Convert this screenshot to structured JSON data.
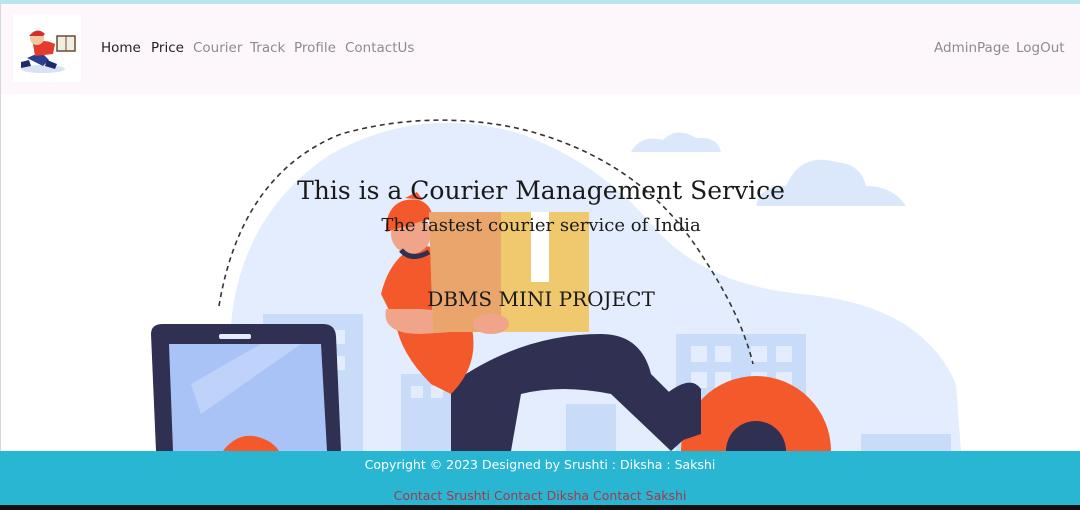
{
  "navbar": {
    "logo_alt": "courier delivery logo",
    "left_links": [
      {
        "label": "Home",
        "active": true
      },
      {
        "label": "Price",
        "active": true
      },
      {
        "label": "Courier",
        "active": false
      },
      {
        "label": "Track",
        "active": false
      },
      {
        "label": "Profile",
        "active": false
      },
      {
        "label": "ContactUs",
        "active": false
      }
    ],
    "right_links": [
      {
        "label": "AdminPage"
      },
      {
        "label": "LogOut"
      }
    ]
  },
  "hero": {
    "title": "This is a Courier Management Service",
    "subtitle": "The fastest courier service of India",
    "project_label": "DBMS MINI PROJECT"
  },
  "footer": {
    "copyright": "Copyright © 2023 Designed by Srushti : Diksha : Sakshi",
    "contacts": [
      "Contact Srushti",
      "Contact Diksha",
      "Contact Sakshi"
    ]
  },
  "colors": {
    "navbar_bg": "#fdf7fb",
    "footer_bg": "#29b6d2",
    "accent_orange": "#f4592c",
    "illustration_blue": "#e3edfd",
    "contact_link": "#a23a4a"
  }
}
